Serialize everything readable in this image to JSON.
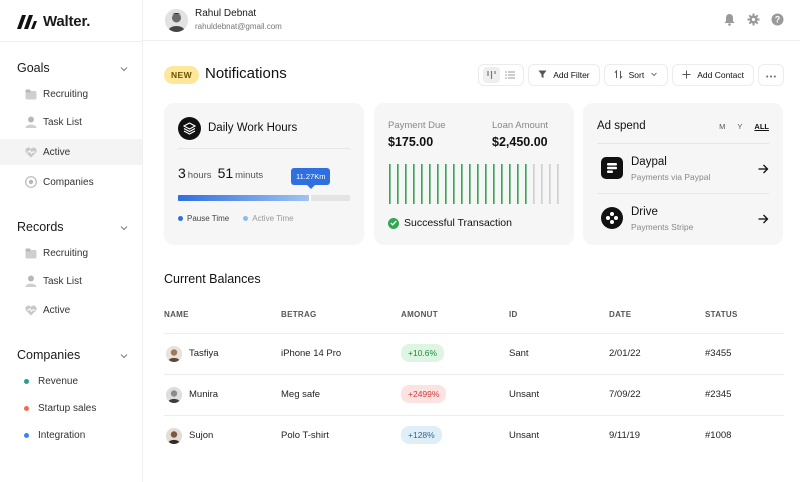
{
  "app": {
    "name": "Walter."
  },
  "user": {
    "name": "Rahul Debnat",
    "email": "rahuldebnat@gmail.com"
  },
  "sidebar": {
    "goals": {
      "title": "Goals",
      "items": [
        {
          "label": "Recruiting",
          "icon": "folder-icon"
        },
        {
          "label": "Task List",
          "icon": "user-icon"
        },
        {
          "label": "Active",
          "icon": "heart-icon"
        },
        {
          "label": "Companies",
          "icon": "target-icon"
        }
      ]
    },
    "records": {
      "title": "Records",
      "items": [
        {
          "label": "Recruiting",
          "icon": "folder-icon"
        },
        {
          "label": "Task List",
          "icon": "user-icon"
        },
        {
          "label": "Active",
          "icon": "heart-icon"
        }
      ]
    },
    "companies": {
      "title": "Companies",
      "items": [
        {
          "label": "Revenue",
          "color": "#2a9d8f"
        },
        {
          "label": "Startup sales",
          "color": "#f26b4f"
        },
        {
          "label": "Integration",
          "color": "#3b82f6"
        }
      ]
    }
  },
  "header": {
    "badge": "NEW",
    "title": "Notifications",
    "buttons": {
      "filter": "Add Filter",
      "sort": "Sort",
      "add_contact": "Add Contact"
    }
  },
  "work_hours": {
    "title": "Daily Work Hours",
    "hours": "3",
    "hours_unit": "hours",
    "minutes": "51",
    "minutes_unit": "minuts",
    "tooltip": "11.27Km",
    "progress": 0.76,
    "legend": {
      "pause": "Pause Time",
      "active": "Active Time"
    },
    "colors": {
      "pause": "#2f6fdf",
      "active": "#8bbcf0"
    }
  },
  "payment": {
    "due_label": "Payment Due",
    "due_value": "$175.00",
    "loan_label": "Loan Amount",
    "loan_value": "$2,450.00",
    "status": "Successful Transaction",
    "bars_filled": 18,
    "bars_total": 22,
    "colors": {
      "filled": "#2fa84f",
      "empty": "#cfcfcf"
    }
  },
  "ad_spend": {
    "title": "Ad spend",
    "periods": [
      "M",
      "Y",
      "ALL"
    ],
    "selected": "ALL",
    "items": [
      {
        "name": "Daypal",
        "sub": "Payments via Paypal"
      },
      {
        "name": "Drive",
        "sub": "Payments Stripe"
      }
    ]
  },
  "balances": {
    "title": "Current Balances",
    "columns": [
      "NAME",
      "BETRAG",
      "AMONUT",
      "ID",
      "DATE",
      "STATUS"
    ],
    "rows": [
      {
        "name": "Tasfiya",
        "betrag": "iPhone 14 Pro",
        "amount": "+10.6%",
        "tone": "green",
        "id": "Sant",
        "date": "2/01/22",
        "status": "#3455"
      },
      {
        "name": "Munira",
        "betrag": "Meg safe",
        "amount": "+2499%",
        "tone": "red",
        "id": "Unsant",
        "date": "7/09/22",
        "status": "#2345"
      },
      {
        "name": "Sujon",
        "betrag": "Polo T-shirt",
        "amount": "+128%",
        "tone": "blue",
        "id": "Unsant",
        "date": "9/11/19",
        "status": "#1008"
      }
    ]
  }
}
